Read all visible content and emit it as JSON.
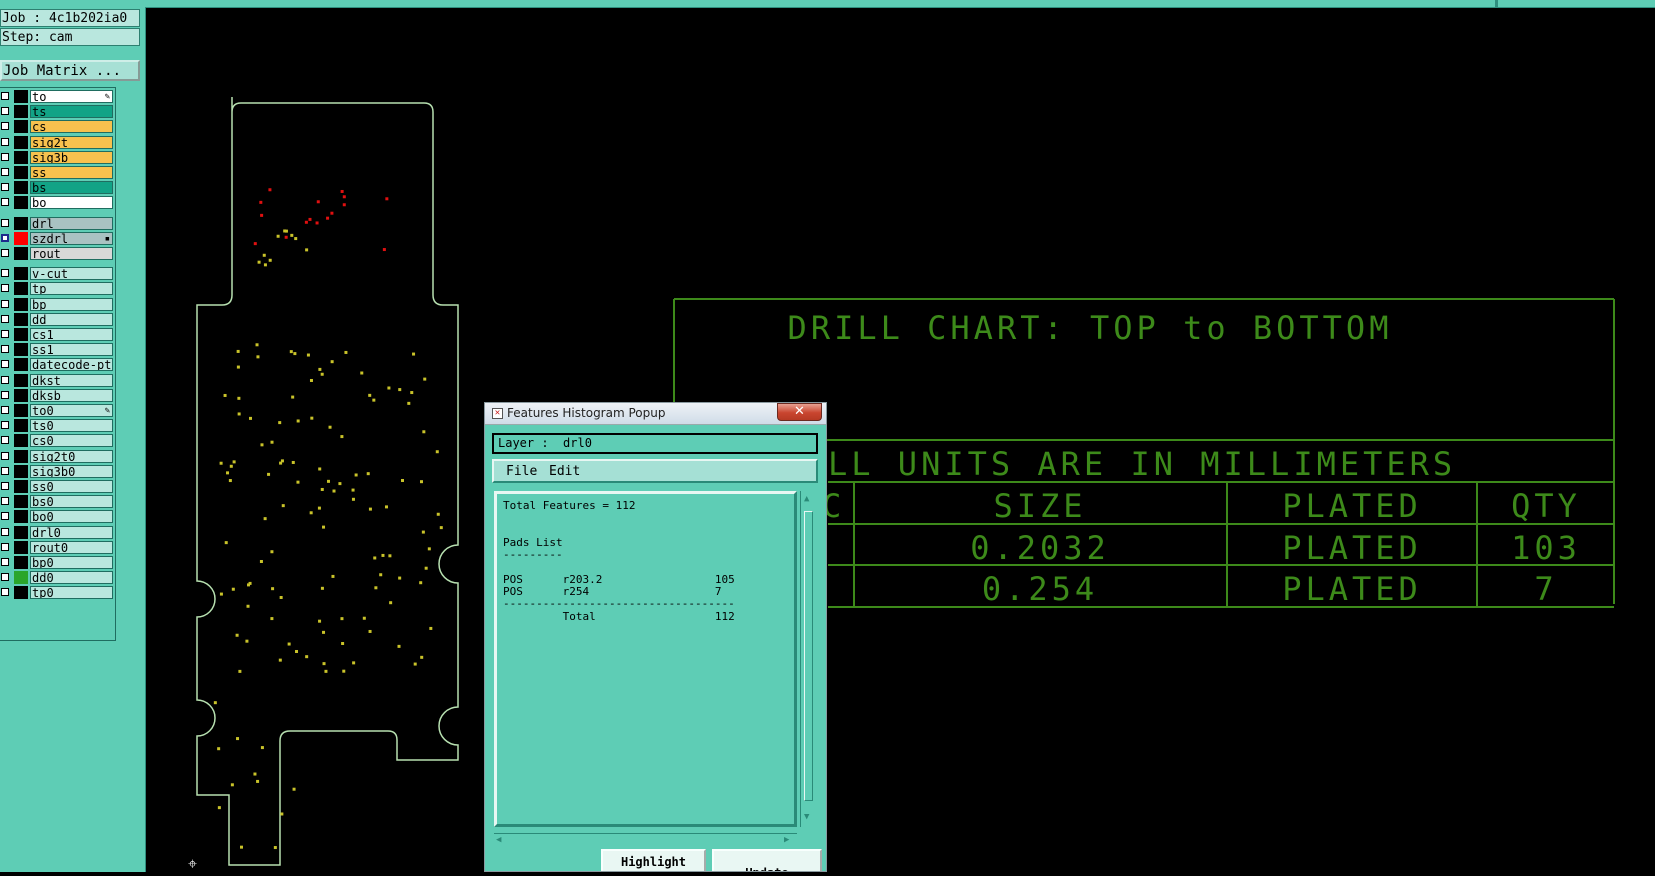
{
  "job_label": "Job : 4c1b202ia0",
  "step_label": "Step: cam",
  "job_matrix_button": "Job Matrix ...",
  "layers": [
    {
      "name": "to",
      "bg": "#ffffff",
      "swatch": "#000000",
      "mark": "✎"
    },
    {
      "name": "ts",
      "bg": "#12a386",
      "swatch": "#000000"
    },
    {
      "name": "cs",
      "bg": "#f7c14e",
      "swatch": "#000000"
    },
    {
      "name": "sig2t",
      "bg": "#f7c14e",
      "swatch": "#000000"
    },
    {
      "name": "sig3b",
      "bg": "#f7c14e",
      "swatch": "#000000"
    },
    {
      "name": "ss",
      "bg": "#f7c14e",
      "swatch": "#000000"
    },
    {
      "name": "bs",
      "bg": "#12a386",
      "swatch": "#000000"
    },
    {
      "name": "bo",
      "bg": "#ffffff",
      "swatch": "#000000"
    },
    {
      "name": "drl",
      "bg": "#a9c2c2",
      "swatch": "#000000",
      "gap": true
    },
    {
      "name": "szdrl",
      "bg": "#a9c2c2",
      "swatch": "#ff0000",
      "selected": true,
      "mark": "▪"
    },
    {
      "name": "rout",
      "bg": "#d8d8d8",
      "swatch": "#000000"
    },
    {
      "name": "v-cut",
      "bg": "#b9e7de",
      "swatch": "#000000",
      "gap": true
    },
    {
      "name": "tp",
      "bg": "#b9e7de",
      "swatch": "#000000"
    },
    {
      "name": "bp",
      "bg": "#b9e7de",
      "swatch": "#000000"
    },
    {
      "name": "dd",
      "bg": "#b9e7de",
      "swatch": "#000000"
    },
    {
      "name": "cs1",
      "bg": "#b9e7de",
      "swatch": "#000000"
    },
    {
      "name": "ss1",
      "bg": "#b9e7de",
      "swatch": "#000000"
    },
    {
      "name": "datecode-pt",
      "bg": "#b9e7de",
      "swatch": "#000000"
    },
    {
      "name": "dkst",
      "bg": "#b9e7de",
      "swatch": "#000000"
    },
    {
      "name": "dksb",
      "bg": "#b9e7de",
      "swatch": "#000000"
    },
    {
      "name": "to0",
      "bg": "#b9e7de",
      "swatch": "#000000",
      "mark": "✎"
    },
    {
      "name": "ts0",
      "bg": "#b9e7de",
      "swatch": "#000000"
    },
    {
      "name": "cs0",
      "bg": "#b9e7de",
      "swatch": "#000000"
    },
    {
      "name": "sig2t0",
      "bg": "#b9e7de",
      "swatch": "#000000"
    },
    {
      "name": "sig3b0",
      "bg": "#b9e7de",
      "swatch": "#000000"
    },
    {
      "name": "ss0",
      "bg": "#b9e7de",
      "swatch": "#000000"
    },
    {
      "name": "bs0",
      "bg": "#b9e7de",
      "swatch": "#000000"
    },
    {
      "name": "bo0",
      "bg": "#b9e7de",
      "swatch": "#000000"
    },
    {
      "name": "drl0",
      "bg": "#b9e7de",
      "swatch": "#000000"
    },
    {
      "name": "rout0",
      "bg": "#b9e7de",
      "swatch": "#000000"
    },
    {
      "name": "bp0",
      "bg": "#b9e7de",
      "swatch": "#000000"
    },
    {
      "name": "dd0",
      "bg": "#b9e7de",
      "swatch": "#2aa52a"
    },
    {
      "name": "tp0",
      "bg": "#b9e7de",
      "swatch": "#000000"
    }
  ],
  "drill_chart": {
    "title": "DRILL CHART: TOP to BOTTOM",
    "units": "LL UNITS ARE IN MILLIMETERS",
    "headers": [
      "C",
      "SIZE",
      "PLATED",
      "QTY"
    ],
    "rows": [
      [
        "",
        "0.2032",
        "PLATED",
        "103"
      ],
      [
        "",
        "0.254",
        "PLATED",
        "7"
      ]
    ],
    "color": "#3d8a1a"
  },
  "popup": {
    "title": "Features Histogram Popup",
    "close": "✕",
    "layer_label": "Layer :  drl0",
    "menu": [
      "File",
      "Edit"
    ],
    "lines": [
      "Total Features = 112",
      "",
      "",
      "Pads List",
      "---------",
      "",
      "POS      r203.2                 105",
      "POS      r254                   7",
      "-----------------------------------",
      "         Total                  112"
    ],
    "buttons": [
      "Highlight",
      "Update"
    ]
  },
  "colors": {
    "panel": "#5ecdb5",
    "board_outline": "#b7e0b0",
    "pad_yellow": "#c9c32a",
    "drill_red": "#e01010"
  }
}
